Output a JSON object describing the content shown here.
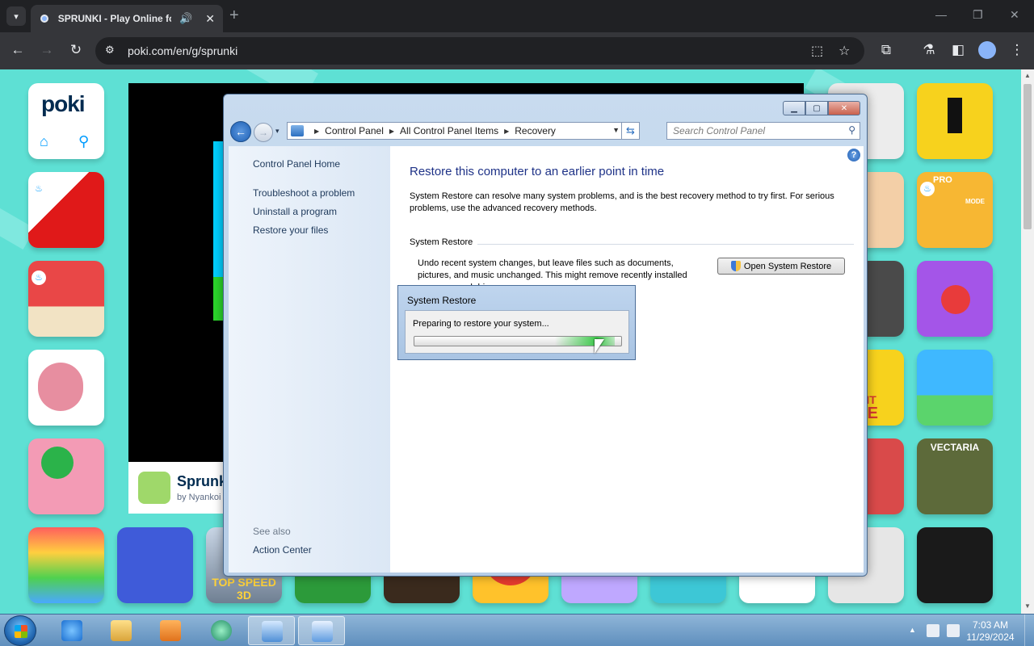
{
  "browser": {
    "tab_title": "SPRUNKI - Play Online for Free!",
    "url": "poki.com/en/g/sprunki",
    "new_tab": "+",
    "close": "✕"
  },
  "poki": {
    "logo": "poki",
    "game_title": "Sprunki",
    "game_author": "by Nyankoi",
    "thumb_labels": {
      "top_speed": "TOP SPEED 3D",
      "vectaria": "VECTARIA",
      "pro": "PRO",
      "mode": "MODE",
      "eit": "E IT",
      "me": "ME"
    }
  },
  "control_panel": {
    "breadcrumbs": [
      "Control Panel",
      "All Control Panel Items",
      "Recovery"
    ],
    "search_placeholder": "Search Control Panel",
    "left_nav": {
      "home": "Control Panel Home",
      "troubleshoot": "Troubleshoot a problem",
      "uninstall": "Uninstall a program",
      "restore_files": "Restore your files",
      "see_also": "See also",
      "action_center": "Action Center"
    },
    "heading": "Restore this computer to an earlier point in time",
    "description": "System Restore can resolve many system problems, and is the best recovery method to try first. For serious problems, use the advanced recovery methods.",
    "section_title": "System Restore",
    "section_desc": "Undo recent system changes, but leave files such as documents, pictures, and music unchanged. This might remove recently installed programs and drivers.",
    "open_button": "Open System Restore"
  },
  "sr_dialog": {
    "title": "System Restore",
    "message": "Preparing to restore your system...",
    "progress_marquee_start": 0.68,
    "progress_marquee_end": 0.97
  },
  "taskbar": {
    "time": "7:03 AM",
    "date": "11/29/2024"
  },
  "colors": {
    "poki_bg": "#5ee0d4",
    "poki_blue": "#009cff",
    "win7_link": "#1e395b",
    "win7_heading": "#1e3287",
    "progress_green": "#3dc94b"
  }
}
